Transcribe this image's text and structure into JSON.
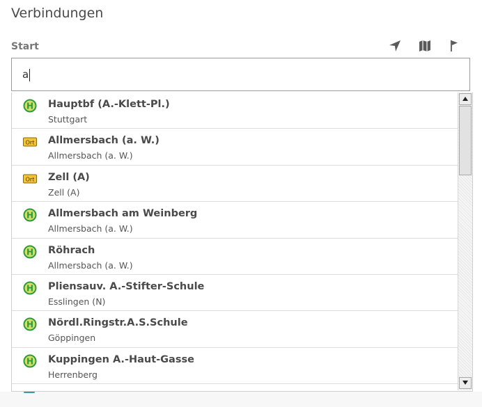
{
  "header": {
    "title": "Verbindungen"
  },
  "start": {
    "label": "Start",
    "input_value": "a",
    "icons": [
      "location-arrow-icon",
      "map-icon",
      "flag-icon"
    ]
  },
  "suggestions": [
    {
      "type": "stop",
      "badge": "H",
      "name": "Hauptbf (A.-Klett-Pl.)",
      "sub": "Stuttgart"
    },
    {
      "type": "place",
      "badge": "Ort",
      "name": "Allmersbach (a. W.)",
      "sub": "Allmersbach (a. W.)"
    },
    {
      "type": "place",
      "badge": "Ort",
      "name": "Zell (A)",
      "sub": "Zell (A)"
    },
    {
      "type": "stop",
      "badge": "H",
      "name": "Allmersbach am Weinberg",
      "sub": "Allmersbach (a. W.)"
    },
    {
      "type": "stop",
      "badge": "H",
      "name": "Röhrach",
      "sub": "Allmersbach (a. W.)"
    },
    {
      "type": "stop",
      "badge": "H",
      "name": "Pliensauv. A.-Stifter-Schule",
      "sub": "Esslingen (N)"
    },
    {
      "type": "stop",
      "badge": "H",
      "name": "Nördl.Ringstr.A.S.Schule",
      "sub": "Göppingen"
    },
    {
      "type": "stop",
      "badge": "H",
      "name": "Kuppingen A.-Haut-Gasse",
      "sub": "Herrenberg"
    }
  ],
  "colors": {
    "stop_icon_fill": "#cfe06a",
    "stop_icon_ring": "#2f9a3a",
    "place_icon_fill": "#f2c23a",
    "place_icon_border": "#8a6a00"
  }
}
